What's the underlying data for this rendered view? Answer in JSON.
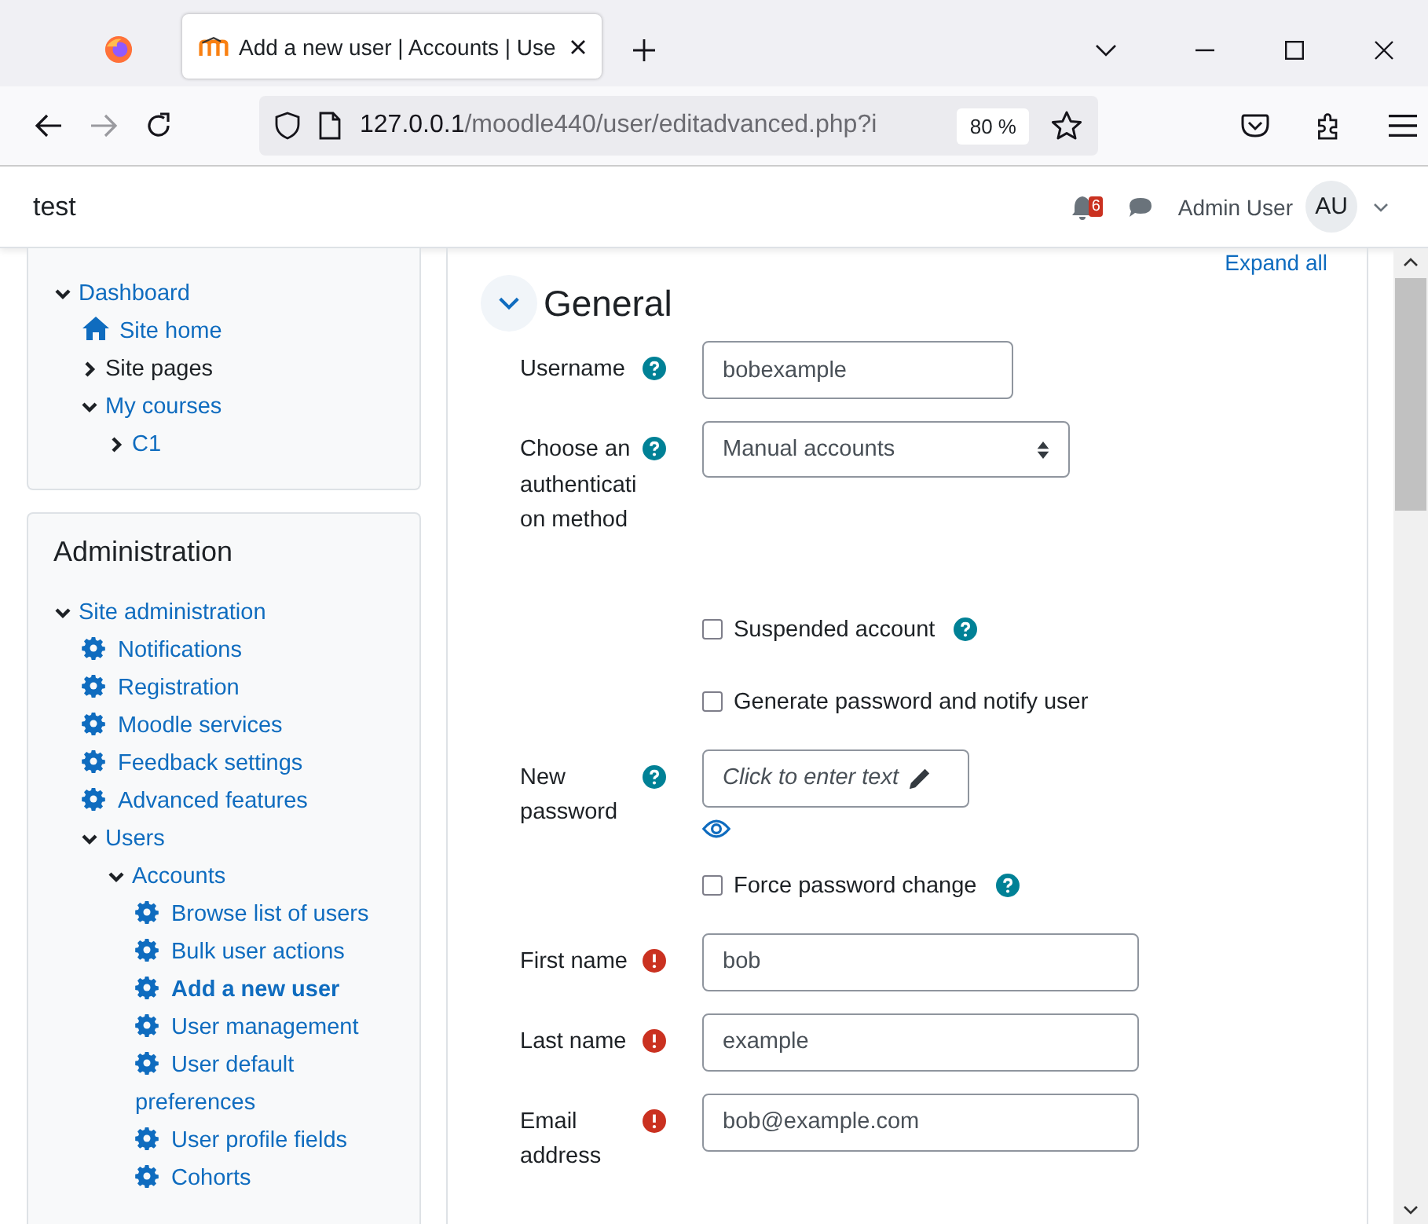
{
  "browser": {
    "tab_title": "Add a new user | Accounts | Use",
    "url_host": "127.0.0.1",
    "url_path": "/moodle440/user/editadvanced.php?i",
    "zoom": "80 %"
  },
  "navbar": {
    "site_name": "test",
    "notification_count": "6",
    "user_name": "Admin User",
    "avatar_initials": "AU"
  },
  "nav_tree": [
    {
      "label": "Dashboard",
      "kind": "branch",
      "expanded": true,
      "link": true,
      "selected": false,
      "children": [
        {
          "label": "Site home",
          "kind": "home",
          "link": true,
          "selected": false
        },
        {
          "label": "Site pages",
          "kind": "branch",
          "expanded": false,
          "link": false,
          "selected": false
        },
        {
          "label": "My courses",
          "kind": "branch",
          "expanded": true,
          "link": true,
          "selected": false,
          "children": [
            {
              "label": "C1",
              "kind": "branch",
              "expanded": false,
              "link": true,
              "selected": false
            }
          ]
        }
      ]
    }
  ],
  "admin_block": {
    "title": "Administration",
    "tree": [
      {
        "label": "Site administration",
        "kind": "branch",
        "expanded": true,
        "link": true,
        "selected": false,
        "children": [
          {
            "label": "Notifications",
            "kind": "setting",
            "link": true,
            "selected": false
          },
          {
            "label": "Registration",
            "kind": "setting",
            "link": true,
            "selected": false
          },
          {
            "label": "Moodle services",
            "kind": "setting",
            "link": true,
            "selected": false
          },
          {
            "label": "Feedback settings",
            "kind": "setting",
            "link": true,
            "selected": false
          },
          {
            "label": "Advanced features",
            "kind": "setting",
            "link": true,
            "selected": false
          },
          {
            "label": "Users",
            "kind": "branch",
            "expanded": true,
            "link": true,
            "selected": false,
            "children": [
              {
                "label": "Accounts",
                "kind": "branch",
                "expanded": true,
                "link": true,
                "selected": false,
                "children": [
                  {
                    "label": "Browse list of users",
                    "kind": "setting",
                    "link": true,
                    "selected": false
                  },
                  {
                    "label": "Bulk user actions",
                    "kind": "setting",
                    "link": true,
                    "selected": false
                  },
                  {
                    "label": "Add a new user",
                    "kind": "setting",
                    "link": true,
                    "selected": true
                  },
                  {
                    "label": "User management",
                    "kind": "setting",
                    "link": true,
                    "selected": false
                  },
                  {
                    "label": "User default preferences",
                    "kind": "setting",
                    "link": true,
                    "selected": false
                  },
                  {
                    "label": "User profile fields",
                    "kind": "setting",
                    "link": true,
                    "selected": false
                  },
                  {
                    "label": "Cohorts",
                    "kind": "setting",
                    "link": true,
                    "selected": false
                  }
                ]
              }
            ]
          }
        ]
      }
    ]
  },
  "form": {
    "expand_all": "Expand all",
    "section": {
      "title": "General",
      "expanded": true
    },
    "fields": [
      {
        "kind": "text",
        "label": "Username",
        "help": true,
        "required": false,
        "value": "bobexample",
        "wide": false
      },
      {
        "kind": "select",
        "label": "Choose an authentication method",
        "help": true,
        "required": false,
        "value": "Manual accounts"
      },
      {
        "kind": "checkbox",
        "label": "Suspended account",
        "help": true,
        "checked": false
      },
      {
        "kind": "checkbox",
        "label": "Generate password and notify user",
        "help": false,
        "checked": false
      },
      {
        "kind": "password",
        "label": "New password",
        "help": true,
        "required": false,
        "placeholder": "Click to enter text"
      },
      {
        "kind": "checkbox",
        "label": "Force password change",
        "help": true,
        "checked": false
      },
      {
        "kind": "text",
        "label": "First name",
        "help": false,
        "required": true,
        "value": "bob",
        "wide": true
      },
      {
        "kind": "text",
        "label": "Last name",
        "help": false,
        "required": true,
        "value": "example",
        "wide": true
      },
      {
        "kind": "text",
        "label": "Email address",
        "help": false,
        "required": true,
        "value": "bob@example.com",
        "wide": true
      }
    ]
  }
}
